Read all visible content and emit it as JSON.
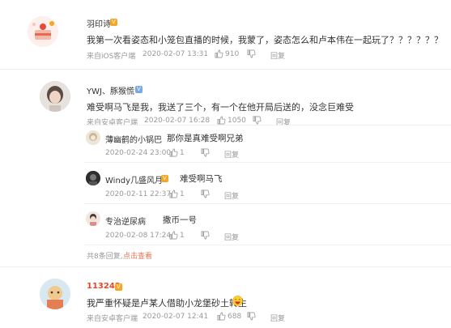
{
  "colors": {
    "accent": "#eb7350",
    "meta": "#999999",
    "name": "#333333",
    "vip_name": "#e8462c",
    "badge": "#f5a623"
  },
  "comments": [
    {
      "user": "羽印诗",
      "text": "我第一次看姿态和小笼包直播的时候，我蒙了，姿态怎么和卢本伟在一起玩了？？？？？？",
      "source": "来自iOS客户端",
      "time": "2020-02-07 13:31",
      "likes": "910",
      "reply_label": "回复"
    },
    {
      "user": "YWJ、豚猴慌",
      "text": "难受啊马飞是我，我送了三个，有一个在他开局后送的，没念巨难受",
      "source": "来自安卓客户端",
      "time": "2020-02-07 16:28",
      "likes": "1050",
      "reply_label": "回复",
      "replies": [
        {
          "user": "薄幽鹤的小锅巴",
          "text": "那你是真难受啊兄弟",
          "time": "2020-02-24 23:00",
          "likes": "1",
          "reply_label": "回复"
        },
        {
          "user": "Windy几盛风月",
          "text": "难受啊马飞",
          "time": "2020-02-11 22:37",
          "likes": "1",
          "reply_label": "回复"
        },
        {
          "user": "专治逆尿病",
          "text": "撒币一号",
          "time": "2020-02-08 17:24",
          "likes": "1",
          "reply_label": "回复"
        }
      ],
      "more_count": "共8条回复,",
      "more_link": "点击查看"
    },
    {
      "user": "113243",
      "text": "我严重怀疑是卢某人借助小龙堡砂土转生",
      "source": "来自安卓客户端",
      "time": "2020-02-07 12:41",
      "likes": "688",
      "reply_label": "回复"
    }
  ]
}
